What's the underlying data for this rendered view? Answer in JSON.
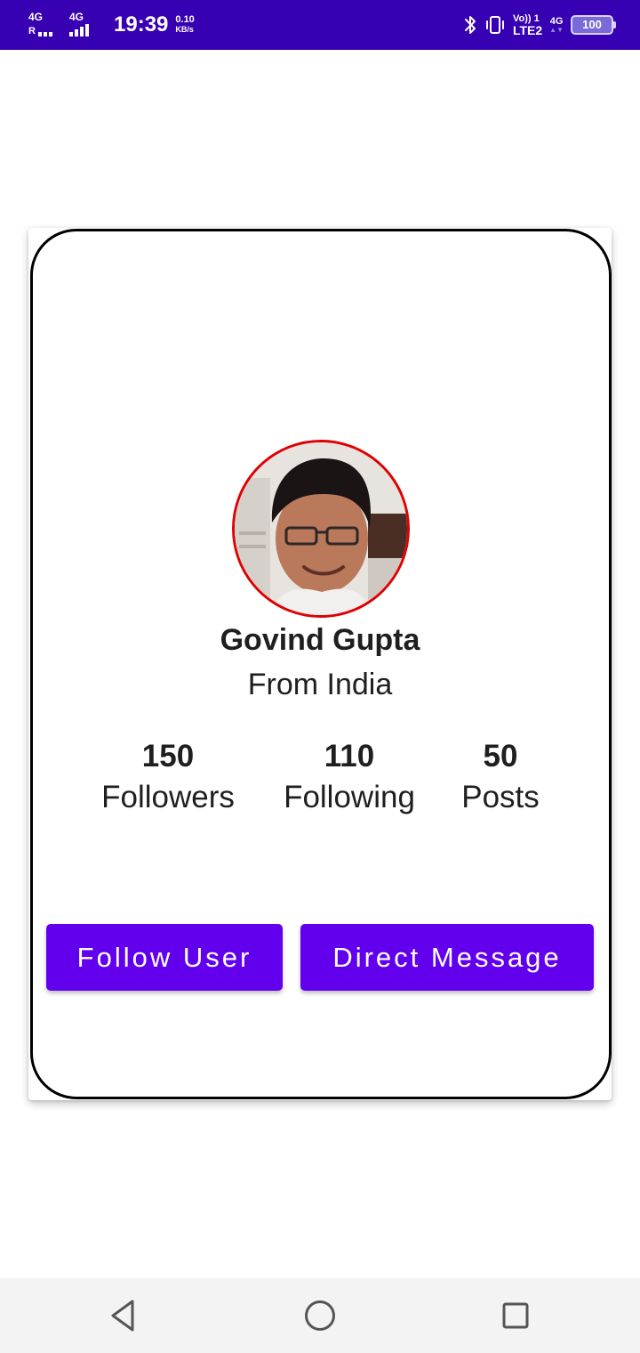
{
  "status_bar": {
    "sim1_type": "4G",
    "sim1_roaming": "R",
    "sim2_type": "4G",
    "time": "19:39",
    "speed_value": "0.10",
    "speed_unit": "KB/s",
    "volte_label": "Vo)) 1",
    "lte_label": "LTE2",
    "data_type": "4G",
    "battery_level": "100",
    "icons": [
      "signal-icon",
      "bluetooth-icon",
      "vibrate-icon",
      "battery-icon"
    ],
    "background_color": "#3700b3"
  },
  "profile": {
    "name": "Govind Gupta",
    "location": "From India",
    "avatar_border_color": "#e00000"
  },
  "stats": {
    "followers": {
      "value": "150",
      "label": "Followers"
    },
    "following": {
      "value": "110",
      "label": "Following"
    },
    "posts": {
      "value": "50",
      "label": "Posts"
    }
  },
  "actions": {
    "follow_label": "Follow User",
    "message_label": "Direct Message",
    "button_color": "#6200ee"
  },
  "nav_bar": {
    "icons": [
      "back-icon",
      "home-icon",
      "recents-icon"
    ]
  }
}
